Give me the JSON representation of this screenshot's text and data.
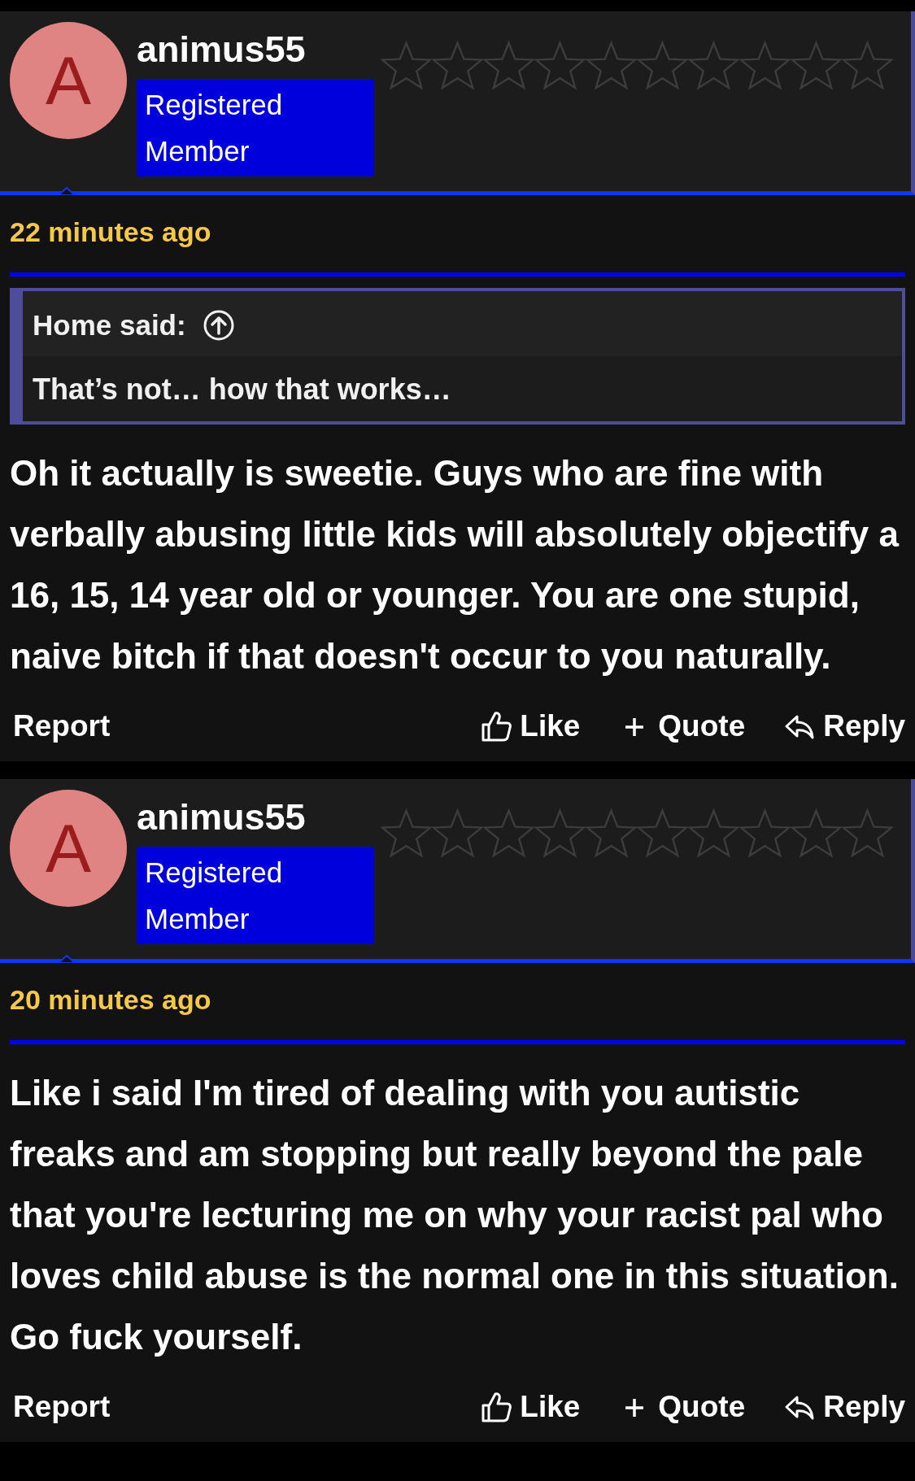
{
  "posts": [
    {
      "author": {
        "initial": "A",
        "name": "animus55",
        "badge": "Registered Member",
        "stars": 0
      },
      "time": "22 minutes ago",
      "quote": {
        "title": "Home said:",
        "text": "That’s not… how that works…"
      },
      "body": "Oh it actually is sweetie. Guys who are fine with verbally abusing little kids will absolutely objectify a 16, 15, 14 year old or younger. You are one stupid, naive bitch if that doesn't occur to you naturally.",
      "actions": {
        "report": "Report",
        "like": "Like",
        "quote": "Quote",
        "reply": "Reply"
      }
    },
    {
      "author": {
        "initial": "A",
        "name": "animus55",
        "badge": "Registered Member",
        "stars": 0
      },
      "time": "20 minutes ago",
      "body": "Like i said I'm tired of dealing with you autistic freaks and am stopping but really beyond the pale that you're lecturing me on why your racist pal who loves child abuse is the normal one in this situation. Go fuck yourself.",
      "actions": {
        "report": "Report",
        "like": "Like",
        "quote": "Quote",
        "reply": "Reply"
      }
    }
  ]
}
